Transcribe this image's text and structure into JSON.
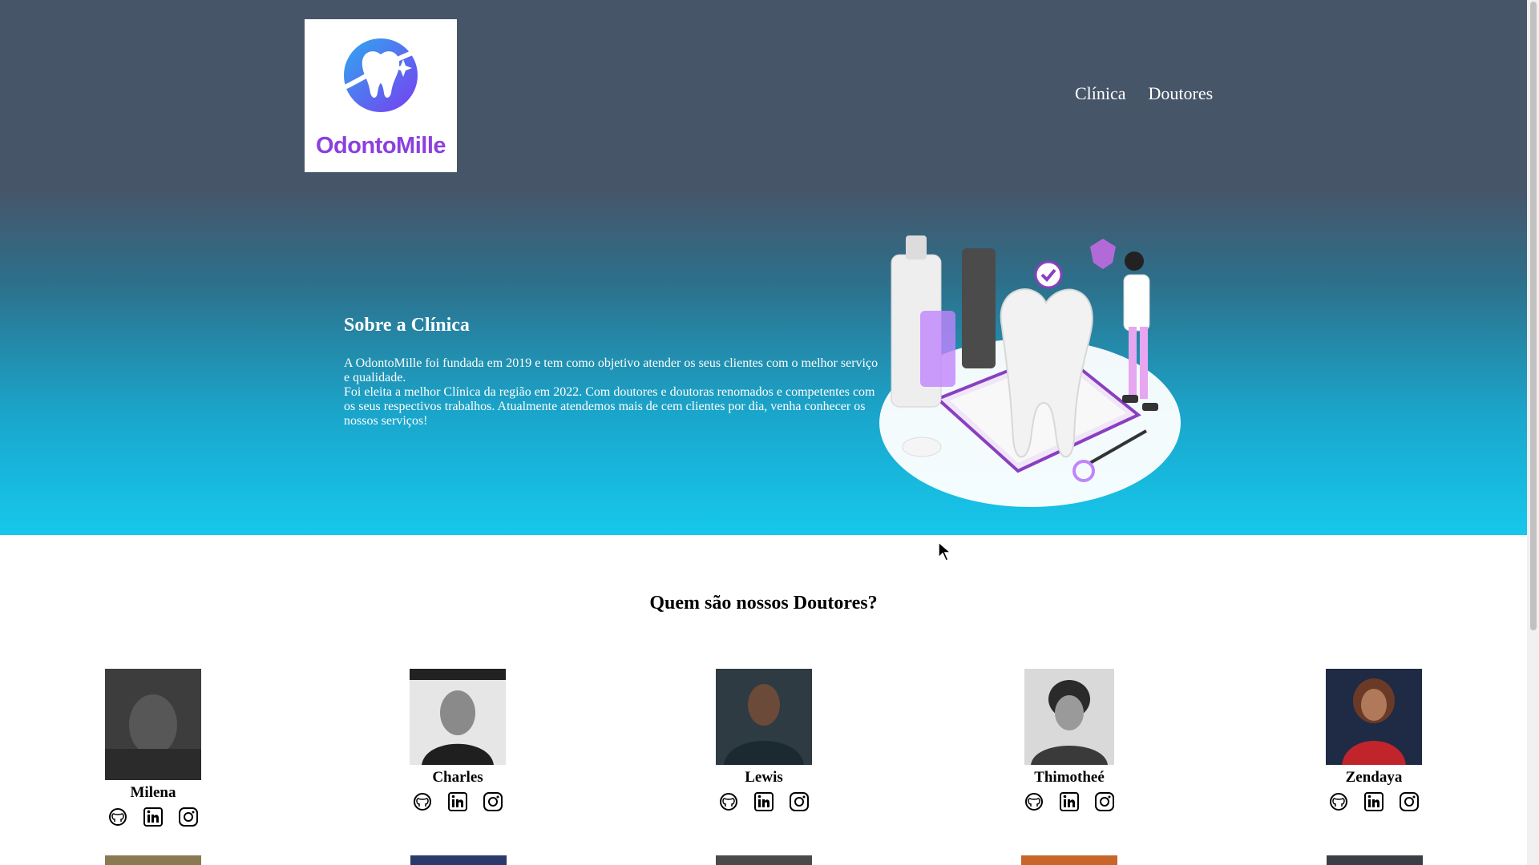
{
  "brand": {
    "name": "OdontoMille",
    "colors": {
      "accent": "#8b3fe0",
      "tooth_blue": "#2f8fe6"
    }
  },
  "nav": {
    "items": [
      "Clínica",
      "Doutores"
    ]
  },
  "about": {
    "title": "Sobre a Clínica",
    "line1": "A OdontoMille foi fundada em 2019 e tem como objetivo atender os seus clientes com o melhor serviço e qualidade.",
    "line2": "Foi eleita a melhor Clínica da região em 2022. Com doutores e doutoras renomados e competentes com os seus respectivos trabalhos. Atualmente atendemos mais de cem clientes por dia, venha conhecer os nossos serviços!"
  },
  "doctors": {
    "title": "Quem são nossos Doutores?",
    "list": [
      {
        "name": "Milena",
        "photo_tone": "#4a4a4a"
      },
      {
        "name": "Charles",
        "photo_tone": "#6b6b6b"
      },
      {
        "name": "Lewis",
        "photo_tone": "#3b4a52"
      },
      {
        "name": "Thimotheé",
        "photo_tone": "#5a5a5a"
      },
      {
        "name": "Zendaya",
        "photo_tone": "#b0252c"
      }
    ],
    "social_icons": [
      "github-icon",
      "linkedin-icon",
      "instagram-icon"
    ]
  }
}
